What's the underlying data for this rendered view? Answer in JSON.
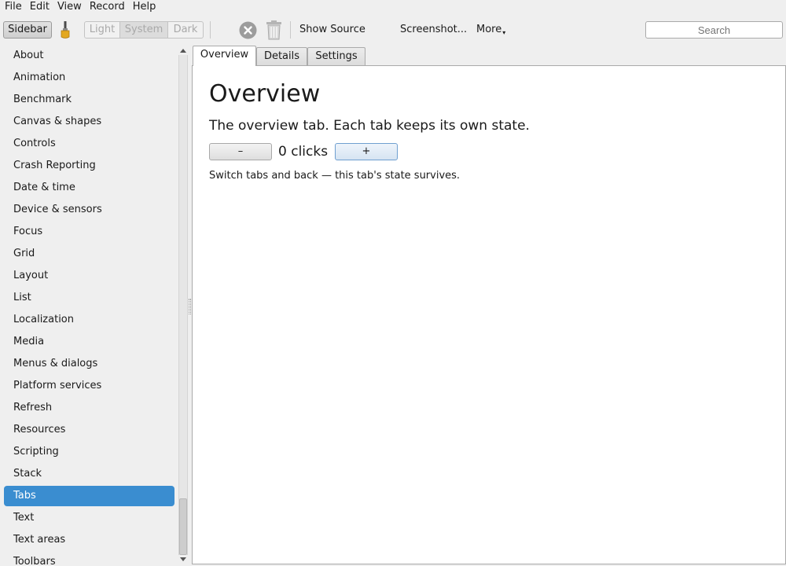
{
  "menubar": {
    "items": [
      "File",
      "Edit",
      "View",
      "Record",
      "Help"
    ]
  },
  "toolbar": {
    "sidebar_label": "Sidebar",
    "theme": {
      "light": "Light",
      "system": "System",
      "dark": "Dark",
      "selected": "System"
    },
    "show_source_label": "Show Source",
    "screenshot_label": "Screenshot...",
    "more_label": "More",
    "search_placeholder": "Search",
    "icons": [
      "paintbrush-icon",
      "stop-icon",
      "trash-icon"
    ]
  },
  "sidebar": {
    "items": [
      "About",
      "Animation",
      "Benchmark",
      "Canvas & shapes",
      "Controls",
      "Crash Reporting",
      "Date & time",
      "Device & sensors",
      "Focus",
      "Grid",
      "Layout",
      "List",
      "Localization",
      "Media",
      "Menus & dialogs",
      "Platform services",
      "Refresh",
      "Resources",
      "Scripting",
      "Stack",
      "Tabs",
      "Text",
      "Text areas",
      "Toolbars"
    ],
    "selected": "Tabs"
  },
  "tabs": {
    "items": [
      "Overview",
      "Details",
      "Settings"
    ],
    "active": "Overview"
  },
  "content": {
    "title": "Overview",
    "description": "The overview tab. Each tab keeps its own state.",
    "minus_label": "–",
    "plus_label": "+",
    "count_label": "0 clicks",
    "hint": "Switch tabs and back — this tab's state survives."
  },
  "colors": {
    "selection": "#3a8dd0",
    "background": "#efefef",
    "panel": "#ffffff"
  }
}
